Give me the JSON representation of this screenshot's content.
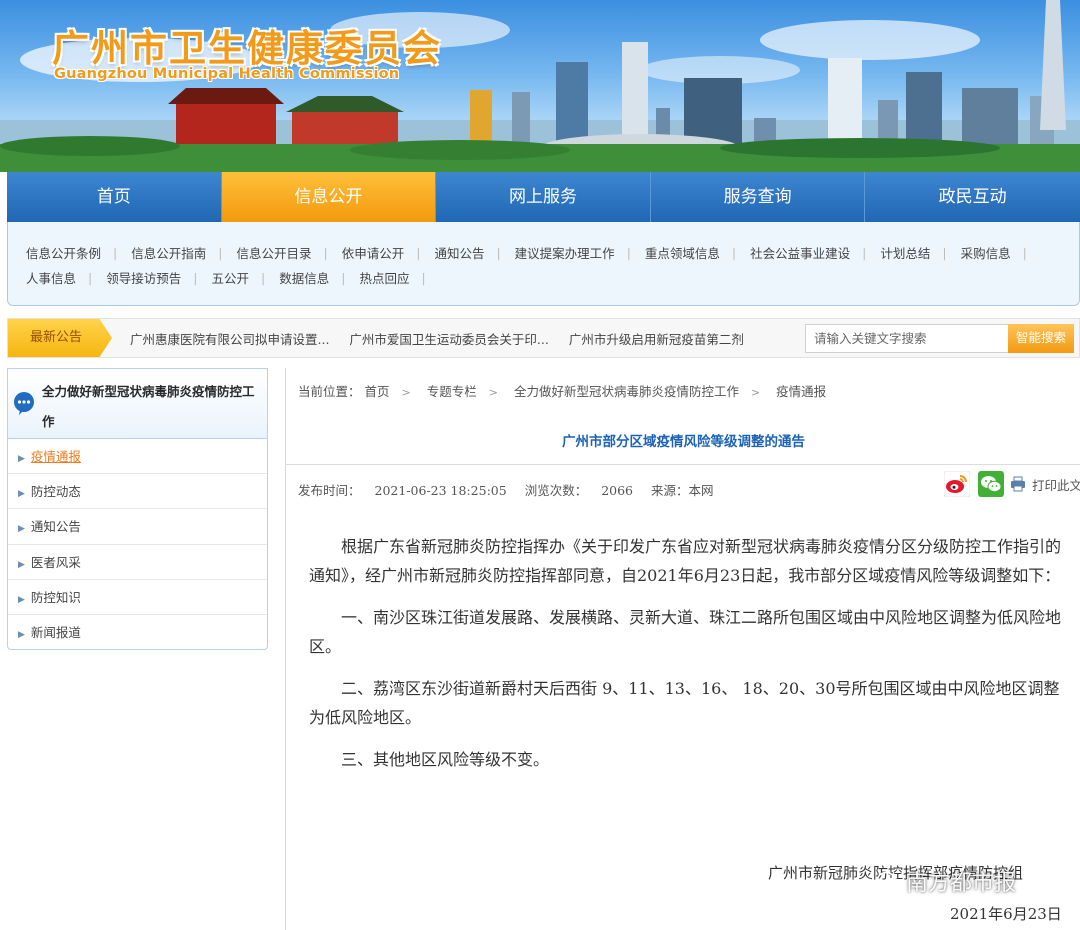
{
  "banner": {
    "title_cn": "广州市卫生健康委员会",
    "title_en": "Guangzhou Municipal Health Commission"
  },
  "main_nav": [
    {
      "label": "首页",
      "active": false
    },
    {
      "label": "信息公开",
      "active": true
    },
    {
      "label": "网上服务",
      "active": false
    },
    {
      "label": "服务查询",
      "active": false
    },
    {
      "label": "政民互动",
      "active": false
    }
  ],
  "sub_nav": {
    "row1": [
      "信息公开条例",
      "信息公开指南",
      "信息公开目录",
      "依申请公开",
      "通知公告",
      "建议提案办理工作",
      "重点领域信息",
      "社会公益事业建设",
      "计划总结",
      "采购信息"
    ],
    "row2": [
      "人事信息",
      "领导接访预告",
      "五公开",
      "数据信息",
      "热点回应"
    ]
  },
  "notice": {
    "label": "最新公告",
    "items": [
      "广州惠康医院有限公司拟申请设置...",
      "广州市爱国卫生运动委员会关于印...",
      "广州市升级启用新冠疫苗第二剂"
    ],
    "search_placeholder": "请输入关键文字搜索",
    "search_button": "智能搜索"
  },
  "sidebar": {
    "title": "全力做好新型冠状病毒肺炎疫情防控工作",
    "items": [
      {
        "label": "疫情通报",
        "active": true
      },
      {
        "label": "防控动态",
        "active": false
      },
      {
        "label": "通知公告",
        "active": false
      },
      {
        "label": "医者风采",
        "active": false
      },
      {
        "label": "防控知识",
        "active": false
      },
      {
        "label": "新闻报道",
        "active": false
      }
    ]
  },
  "breadcrumb": {
    "prefix": "当前位置：",
    "items": [
      "首页",
      "专题专栏",
      "全力做好新型冠状病毒肺炎疫情防控工作",
      "疫情通报"
    ]
  },
  "article": {
    "title": "广州市部分区域疫情风险等级调整的通告",
    "meta": {
      "publish_label": "发布时间：",
      "publish_time": "2021-06-23 18:25:05",
      "views_label": "浏览次数：",
      "views": "2066",
      "source_label": "来源：",
      "source": "本网"
    },
    "print_label": "打印此文",
    "paragraphs": [
      "根据广东省新冠肺炎防控指挥办《关于印发广东省应对新型冠状病毒肺炎疫情分区分级防控工作指引的通知》，经广州市新冠肺炎防控指挥部同意，自2021年6月23日起，我市部分区域疫情风险等级调整如下：",
      "一、南沙区珠江街道发展路、发展横路、灵新大道、珠江二路所包围区域由中风险地区调整为低风险地区。",
      "二、荔湾区东沙街道新爵村天后西街 9、11、13、16、 18、20、30号所包围区域由中风险地区调整为低风险地区。",
      "三、其他地区风险等级不变。"
    ],
    "signature_org": "广州市新冠肺炎防控指挥部疫情防控组",
    "signature_date": "2021年6月23日"
  },
  "watermark": "南方都市报",
  "colors": {
    "nav_blue": "#2167b4",
    "nav_active_orange": "#f39a0e",
    "title_blue": "#1c63b8",
    "active_link_orange": "#f07b1f"
  }
}
